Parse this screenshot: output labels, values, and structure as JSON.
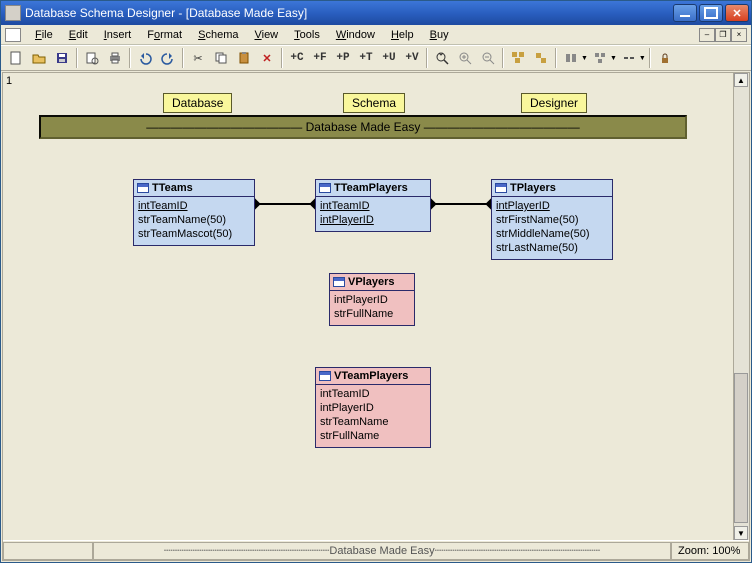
{
  "window": {
    "title": "Database Schema Designer - [Database Made Easy]"
  },
  "menu": {
    "file": "File",
    "edit": "Edit",
    "insert": "Insert",
    "format": "Format",
    "schema": "Schema",
    "view": "View",
    "tools": "Tools",
    "window": "Window",
    "help": "Help",
    "buy": "Buy"
  },
  "toolbar": {
    "addC": "+C",
    "addF": "+F",
    "addP": "+P",
    "addT": "+T",
    "addU": "+U",
    "addV": "+V"
  },
  "canvas": {
    "rownum": "1",
    "tags": {
      "database": "Database",
      "schema": "Schema",
      "designer": "Designer"
    },
    "banner": "Database Made Easy"
  },
  "entities": {
    "tteams": {
      "title": "TTeams",
      "cols": [
        "intTeamID",
        "strTeamName(50)",
        "strTeamMascot(50)"
      ]
    },
    "tteamplayers": {
      "title": "TTeamPlayers",
      "cols": [
        "intTeamID",
        "intPlayerID"
      ]
    },
    "tplayers": {
      "title": "TPlayers",
      "cols": [
        "intPlayerID",
        "strFirstName(50)",
        "strMiddleName(50)",
        "strLastName(50)"
      ]
    },
    "vplayers": {
      "title": "VPlayers",
      "cols": [
        "intPlayerID",
        "strFullName"
      ]
    },
    "vteamplayers": {
      "title": "VTeamPlayers",
      "cols": [
        "intTeamID",
        "intPlayerID",
        "strTeamName",
        "strFullName"
      ]
    }
  },
  "status": {
    "mid": "Database Made Easy",
    "zoom": "Zoom: 100%"
  }
}
